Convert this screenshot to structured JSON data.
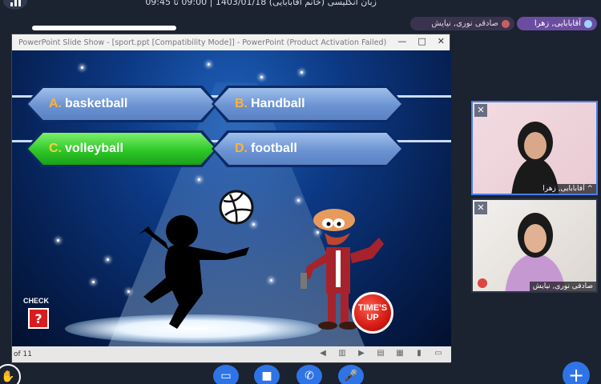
{
  "session": {
    "title": "زبان انگلیسی (خانم آقابابایی) 1403/01/18 | 09:00 تا 09:45"
  },
  "participants": {
    "chip_host": "آقابابایی, زهرا",
    "chip_student": "صادقی نوری, نیایش"
  },
  "ppt": {
    "window_title": "PowerPoint Slide Show - [sport.ppt [Compatibility Mode]] - PowerPoint (Product Activation Failed)",
    "window_controls": [
      "—",
      "□",
      "✕"
    ],
    "status_text": "of 11",
    "answers": [
      {
        "letter": "A.",
        "text": "basketball",
        "state": "normal"
      },
      {
        "letter": "B.",
        "text": "Handball",
        "state": "normal"
      },
      {
        "letter": "C.",
        "text": "volleyball",
        "state": "correct"
      },
      {
        "letter": "D.",
        "text": "football",
        "state": "normal"
      }
    ],
    "check_label": "CHECK",
    "check_symbol": "?",
    "times_up_line1": "TIME'S",
    "times_up_line2": "UP"
  },
  "video_tiles": [
    {
      "name": "^ آقابابایی, زهرا",
      "close": "✕"
    },
    {
      "name": "صادقی نوری, نیایش",
      "close": "✕",
      "mic": "mic-off-icon"
    }
  ],
  "toolbar": {
    "hand": "✋",
    "screen": "▭",
    "camera": "■",
    "phone": "✆",
    "mic": "🎤",
    "plus": "+"
  },
  "colors": {
    "accent": "#2f74e6",
    "correct_answer": "#2fc829",
    "answer_blue": "#6c93d2",
    "answer_letter": "#ffb23a"
  }
}
